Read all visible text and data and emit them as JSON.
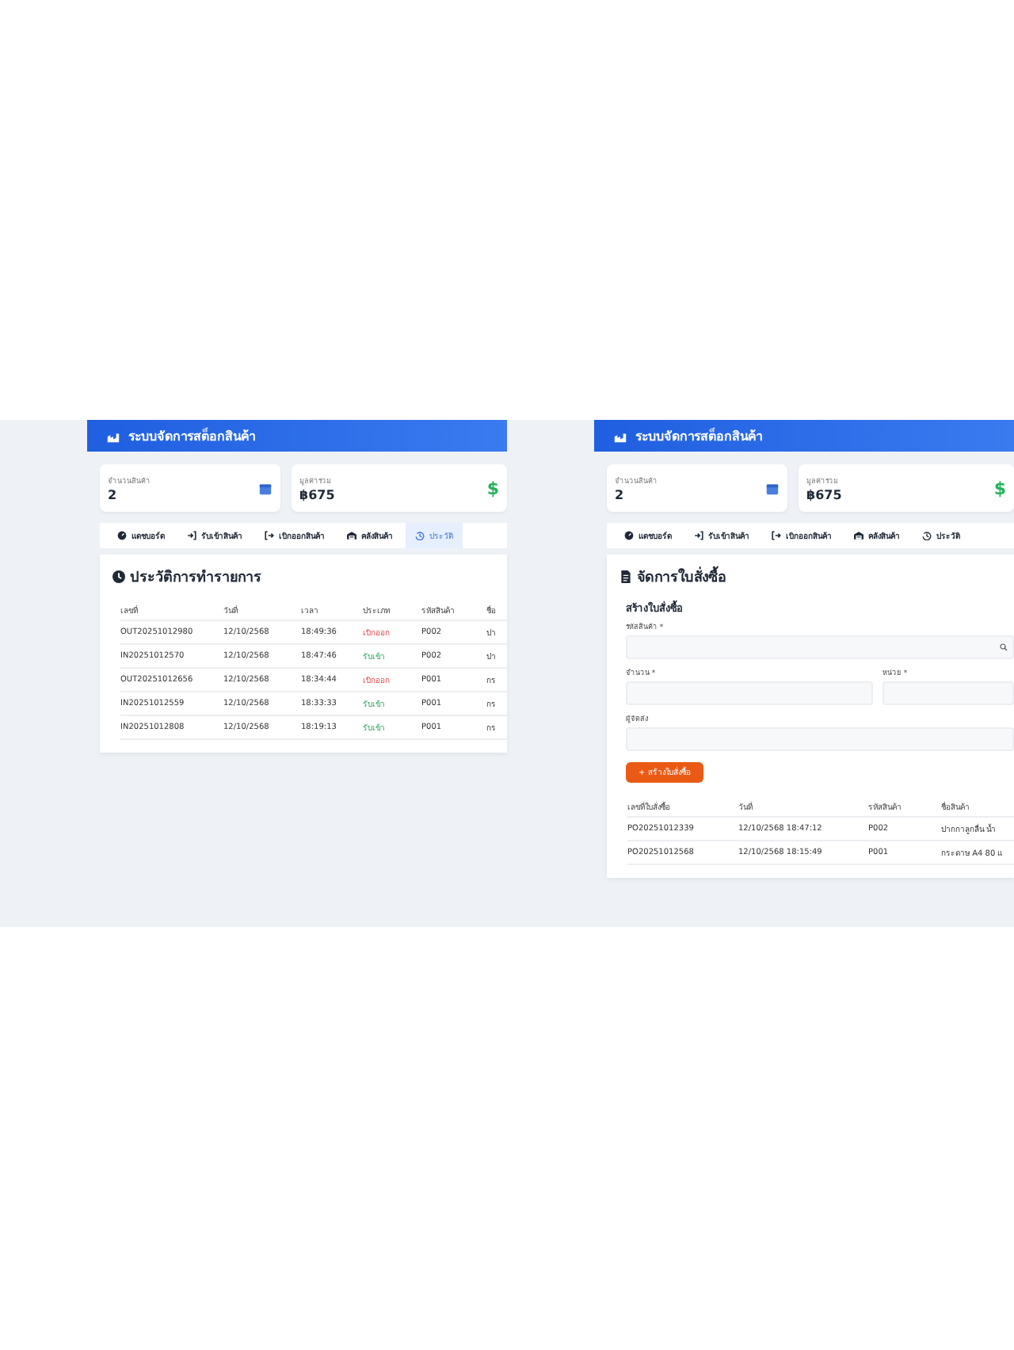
{
  "screens": [
    {
      "header": {
        "title": "ระบบจัดการสต็อกสินค้า"
      },
      "stats": [
        {
          "label": "จำนวนสินค้า",
          "value": "2",
          "kind": "box"
        },
        {
          "label": "มูลค่ารวม",
          "value": "฿675",
          "kind": "money",
          "icon_char": "$"
        }
      ],
      "tabs": [
        {
          "label": "แดชบอร์ด",
          "kind": "gauge",
          "selected": false
        },
        {
          "label": "รับเข้าสินค้า",
          "kind": "in",
          "selected": false
        },
        {
          "label": "เบิกออกสินค้า",
          "kind": "out",
          "selected": false
        },
        {
          "label": "คลังสินค้า",
          "kind": "warehouse",
          "selected": false
        },
        {
          "label": "ประวัติ",
          "kind": "history",
          "selected": true
        }
      ],
      "panel": {
        "kind": "history",
        "title": "ประวัติการทำรายการ",
        "columns": [
          "เลขที่",
          "วันที่",
          "เวลา",
          "ประเภท",
          "รหัสสินค้า",
          "ชื่อ"
        ],
        "rows": [
          {
            "cells": [
              "OUT20251012980",
              "12/10/2568",
              "18:49:36",
              "เบิกออก",
              "P002",
              "ปา"
            ],
            "kind": "out"
          },
          {
            "cells": [
              "IN20251012570",
              "12/10/2568",
              "18:47:46",
              "รับเข้า",
              "P002",
              "ปา"
            ],
            "kind": "in"
          },
          {
            "cells": [
              "OUT20251012656",
              "12/10/2568",
              "18:34:44",
              "เบิกออก",
              "P001",
              "กร"
            ],
            "kind": "out"
          },
          {
            "cells": [
              "IN20251012559",
              "12/10/2568",
              "18:33:33",
              "รับเข้า",
              "P001",
              "กร"
            ],
            "kind": "in"
          },
          {
            "cells": [
              "IN20251012808",
              "12/10/2568",
              "18:19:13",
              "รับเข้า",
              "P001",
              "กร"
            ],
            "kind": "in"
          }
        ]
      }
    },
    {
      "header": {
        "title": "ระบบจัดการสต็อกสินค้า"
      },
      "stats": [
        {
          "label": "จำนวนสินค้า",
          "value": "2",
          "kind": "box"
        },
        {
          "label": "มูลค่ารวม",
          "value": "฿675",
          "kind": "money",
          "icon_char": "$"
        }
      ],
      "tabs": [
        {
          "label": "แดชบอร์ด",
          "kind": "gauge",
          "selected": false
        },
        {
          "label": "รับเข้าสินค้า",
          "kind": "in",
          "selected": false
        },
        {
          "label": "เบิกออกสินค้า",
          "kind": "out",
          "selected": false
        },
        {
          "label": "คลังสินค้า",
          "kind": "warehouse",
          "selected": false
        },
        {
          "label": "ประวัติ",
          "kind": "history",
          "selected": false
        }
      ],
      "panel": {
        "kind": "purchase",
        "title": "จัดการใบสั่งซื้อ",
        "form_title": "สร้างใบสั่งซื้อ",
        "fields": [
          {
            "label": "รหัสสินค้า *",
            "kind": "search"
          },
          {
            "label": "จำนวน *",
            "kind": "half"
          },
          {
            "label": "หน่วย *",
            "kind": "half"
          },
          {
            "label": "ผู้จัดส่ง",
            "kind": "full"
          }
        ],
        "button": "+ สร้างใบสั่งซื้อ",
        "columns": [
          "เลขที่ใบสั่งซื้อ",
          "วันที่",
          "รหัสสินค้า",
          "ชื่อสินค้า"
        ],
        "rows": [
          {
            "cells": [
              "PO20251012339",
              "12/10/2568 18:47:12",
              "P002",
              "ปากกาลูกลื่น น้ำ"
            ]
          },
          {
            "cells": [
              "PO20251012568",
              "12/10/2568 18:15:49",
              "P001",
              "กระดาษ A4 80 แ"
            ]
          }
        ]
      }
    }
  ]
}
